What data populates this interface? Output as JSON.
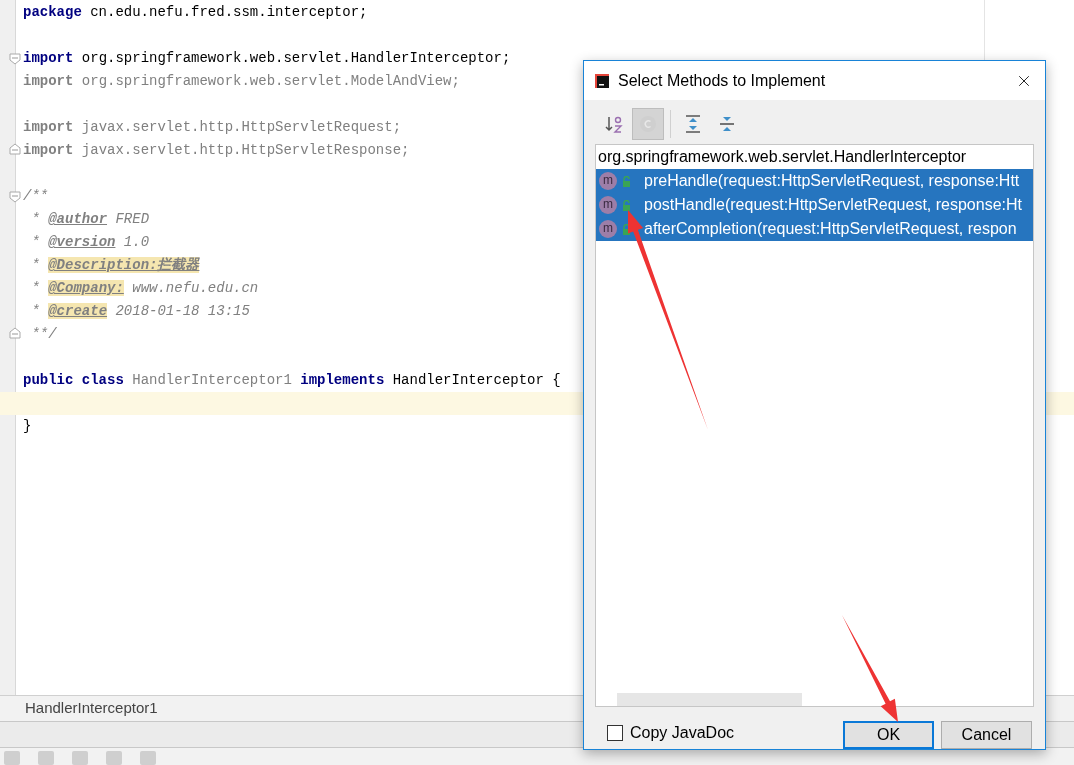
{
  "editor": {
    "lines": [
      {
        "current": false,
        "tokens": [
          {
            "kind": "keyword",
            "text": "package"
          },
          {
            "kind": "plain",
            "text": " cn.edu.nefu.fred.ssm.interceptor;"
          }
        ]
      },
      {
        "current": false
      },
      {
        "fold_start": true,
        "current": false,
        "tokens": [
          {
            "kind": "keyword",
            "text": "import"
          },
          {
            "kind": "plain",
            "text": " org.springframework.web.servlet.HandlerInterceptor;"
          }
        ]
      },
      {
        "current": false,
        "tokens": [
          {
            "kind": "unused_keyword",
            "text": "import"
          },
          {
            "kind": "unused",
            "text": " org.springframework.web.servlet.ModelAndView;"
          }
        ]
      },
      {
        "current": false
      },
      {
        "current": false,
        "tokens": [
          {
            "kind": "unused_keyword",
            "text": "import"
          },
          {
            "kind": "unused",
            "text": " javax.servlet.http.HttpServletRequest;"
          }
        ]
      },
      {
        "fold_end": true,
        "current": false,
        "tokens": [
          {
            "kind": "unused_keyword",
            "text": "import"
          },
          {
            "kind": "unused",
            "text": " javax.servlet.http.HttpServletResponse;"
          }
        ]
      },
      {
        "current": false
      },
      {
        "fold_start": true,
        "current": false,
        "tokens": [
          {
            "kind": "comment",
            "text": "/**"
          }
        ]
      },
      {
        "current": false,
        "tokens": [
          {
            "kind": "comment",
            "text": " * "
          },
          {
            "kind": "doc_tag",
            "text": "@author"
          },
          {
            "kind": "comment",
            "text": " FRED"
          }
        ]
      },
      {
        "current": false,
        "tokens": [
          {
            "kind": "comment",
            "text": " * "
          },
          {
            "kind": "doc_tag",
            "text": "@version"
          },
          {
            "kind": "comment",
            "text": " 1.0"
          }
        ]
      },
      {
        "current": false,
        "tokens": [
          {
            "kind": "comment",
            "text": " * "
          },
          {
            "kind": "doc_tag_marked",
            "text": "@Description:拦截器"
          }
        ]
      },
      {
        "current": false,
        "tokens": [
          {
            "kind": "comment",
            "text": " * "
          },
          {
            "kind": "doc_tag_marked",
            "text": "@Company:"
          },
          {
            "kind": "comment",
            "text": " www.nefu.edu.cn"
          }
        ]
      },
      {
        "current": false,
        "tokens": [
          {
            "kind": "comment",
            "text": " * "
          },
          {
            "kind": "doc_tag_marked",
            "text": "@create"
          },
          {
            "kind": "comment",
            "text": " 2018-01-18 13:15"
          }
        ]
      },
      {
        "fold_end": true,
        "current": false,
        "tokens": [
          {
            "kind": "comment",
            "text": " **/"
          }
        ]
      },
      {
        "current": false
      },
      {
        "current": false,
        "tokens": [
          {
            "kind": "keyword",
            "text": "public class"
          },
          {
            "kind": "unused",
            "text": " HandlerInterceptor1 "
          },
          {
            "kind": "keyword",
            "text": "implements"
          },
          {
            "kind": "plain",
            "text": " HandlerInterceptor {"
          }
        ]
      },
      {
        "current": true
      },
      {
        "current": false,
        "tokens": [
          {
            "kind": "plain",
            "text": "}"
          }
        ]
      }
    ]
  },
  "breadcrumb": "HandlerInterceptor1",
  "dialog": {
    "title": "Select Methods to Implement",
    "toolbar": [
      {
        "kind": "sort",
        "selected": false
      },
      {
        "kind": "class",
        "selected": true
      },
      {
        "kind": "expand",
        "selected": false
      },
      {
        "kind": "collapse",
        "selected": false
      }
    ],
    "list": {
      "header": "org.springframework.web.servlet.HandlerInterceptor",
      "methods": [
        {
          "icon_letter": "m",
          "text": "preHandle(request:HttpServletRequest, response:Htt",
          "selected": true
        },
        {
          "icon_letter": "m",
          "text": "postHandle(request:HttpServletRequest, response:Ht",
          "selected": true
        },
        {
          "icon_letter": "m",
          "text": "afterCompletion(request:HttpServletRequest, respon",
          "selected": true
        }
      ]
    },
    "copy_javadoc": {
      "label": "Copy JavaDoc",
      "checked": false
    },
    "buttons": [
      {
        "label": "OK",
        "default": true
      },
      {
        "label": "Cancel",
        "default": false
      }
    ]
  }
}
